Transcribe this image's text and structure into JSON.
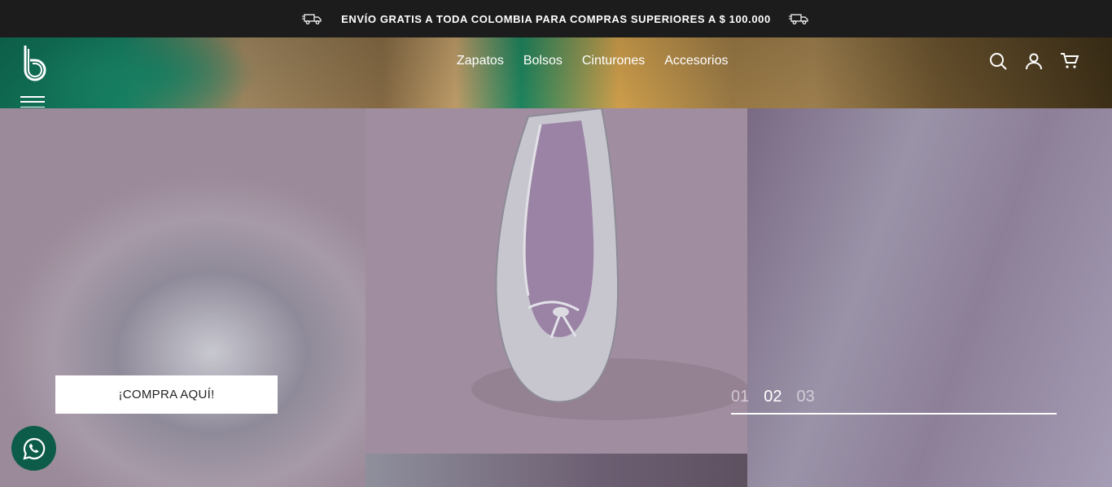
{
  "promo": {
    "text": "ENVÍO GRATIS A TODA COLOMBIA PARA COMPRAS SUPERIORES A $ 100.000",
    "left_icon": "delivery-truck-icon",
    "right_icon": "delivery-truck-icon"
  },
  "header": {
    "logo_icon": "brand-logo-b",
    "menu_icon": "hamburger-menu-icon",
    "nav": [
      {
        "label": "Zapatos"
      },
      {
        "label": "Bolsos"
      },
      {
        "label": "Cinturones"
      },
      {
        "label": "Accesorios"
      }
    ],
    "icons": [
      "search-icon",
      "user-icon",
      "cart-icon"
    ]
  },
  "hero": {
    "cta_label": "¡COMPRA AQUÍ!",
    "pager": [
      "01",
      "02",
      "03"
    ],
    "active_slide": "02"
  },
  "floating": {
    "whatsapp_icon": "whatsapp-icon"
  },
  "colors": {
    "promo_bg": "#1c1c1c",
    "hero_purple": "#a08ea0",
    "whatsapp_green": "#0d5c4a"
  }
}
